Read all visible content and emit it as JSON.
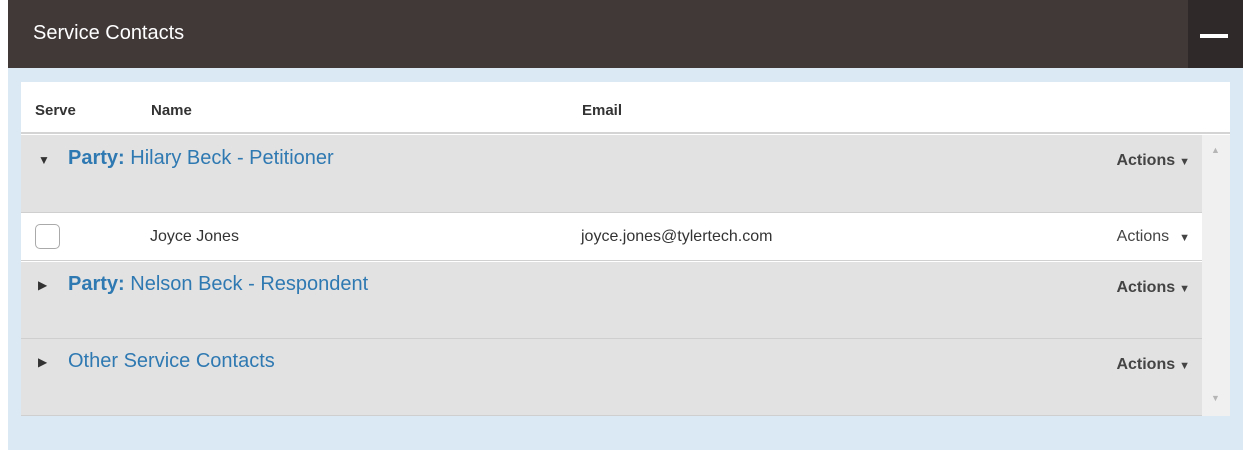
{
  "panel": {
    "title": "Service Contacts",
    "collapse_icon": "minus-icon"
  },
  "table": {
    "columns": [
      "Serve",
      "Name",
      "Email"
    ],
    "groups": [
      {
        "prefix": "Party:",
        "title": "Hilary Beck - Petitioner",
        "expanded": true,
        "actions_label": "Actions",
        "contacts": [
          {
            "serve_checked": false,
            "name": "Joyce Jones",
            "email": "joyce.jones@tylertech.com",
            "actions_label": "Actions"
          }
        ]
      },
      {
        "prefix": "Party:",
        "title": "Nelson Beck - Respondent",
        "expanded": false,
        "actions_label": "Actions",
        "contacts": []
      },
      {
        "prefix": "",
        "title": "Other Service Contacts",
        "expanded": false,
        "actions_label": "Actions",
        "contacts": []
      }
    ]
  },
  "colors": {
    "header_bg": "#413838",
    "panel_bg": "#dbe9f4",
    "group_bg": "#e2e2e2",
    "link": "#2f79b2"
  },
  "icons": {
    "expanded": "caret-down-icon",
    "collapsed": "caret-right-icon",
    "actions_dropdown": "triangle-down-icon"
  }
}
